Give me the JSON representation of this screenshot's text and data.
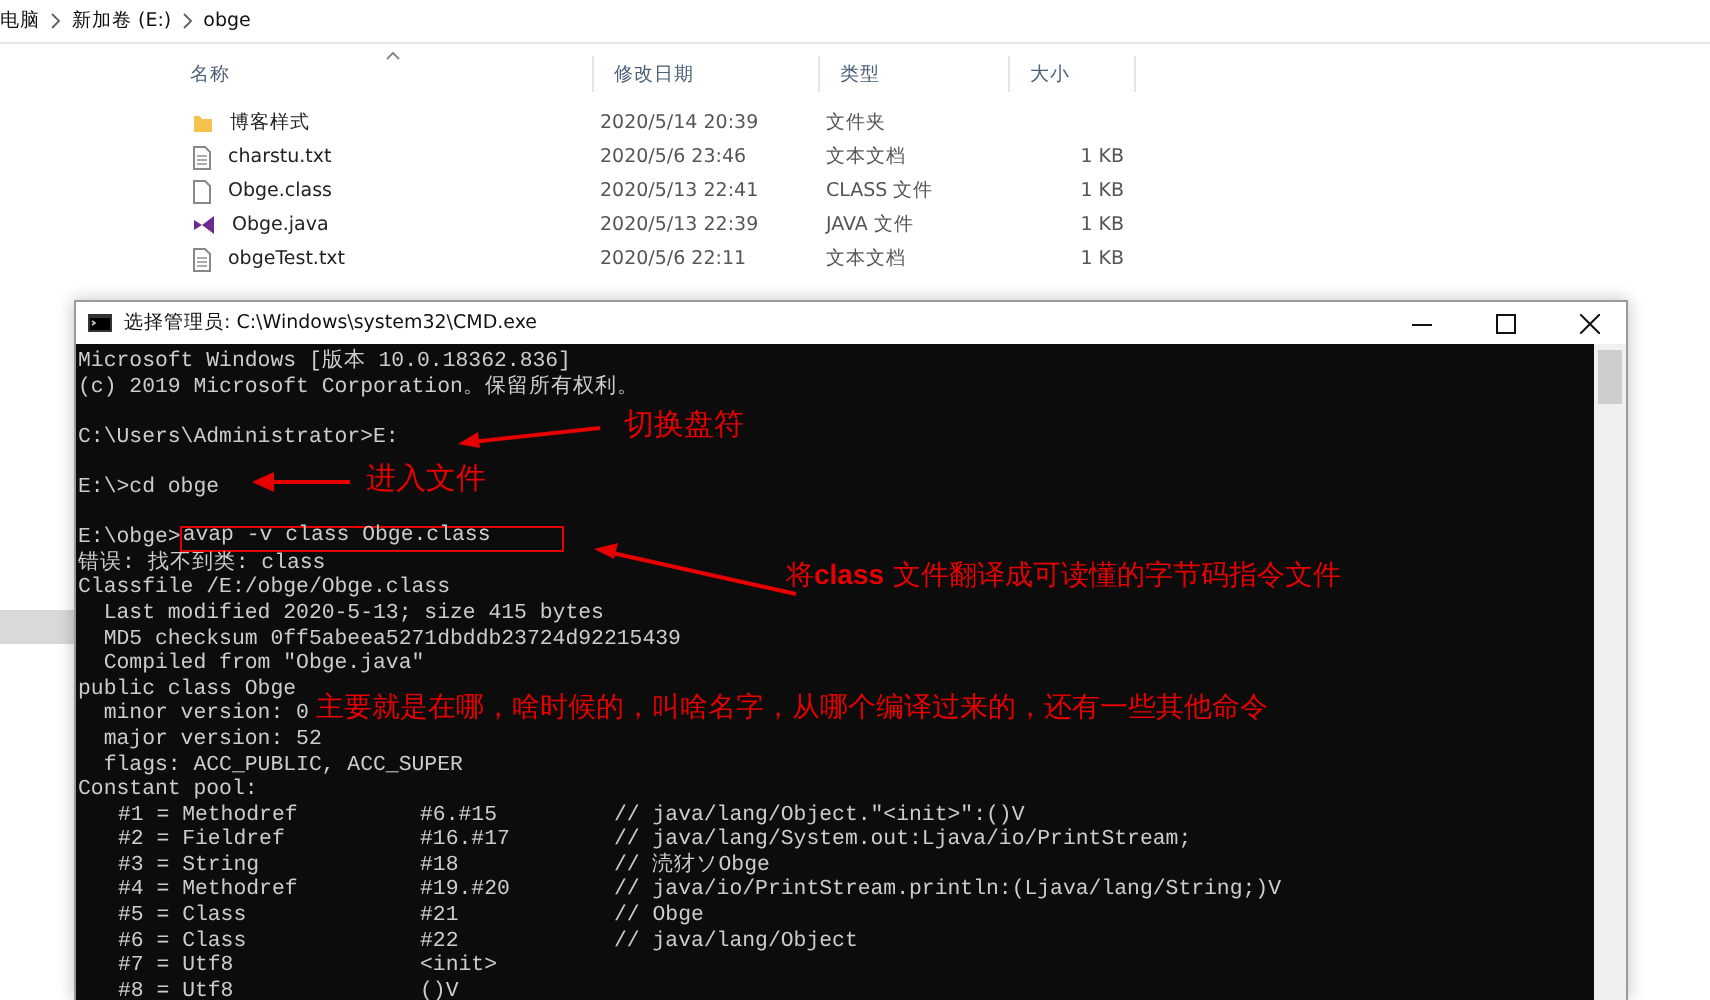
{
  "explorer": {
    "breadcrumb": [
      "电脑",
      "新加卷 (E:)",
      "obge"
    ],
    "columns": [
      {
        "label": "名称",
        "sorted": true
      },
      {
        "label": "修改日期",
        "sorted": false
      },
      {
        "label": "类型",
        "sorted": false
      },
      {
        "label": "大小",
        "sorted": false
      }
    ],
    "files": [
      {
        "kind": "folder",
        "name": "博客样式",
        "modified": "2020/5/14 20:39",
        "type": "文件夹"
      },
      {
        "kind": "text",
        "name": "charstu.txt",
        "modified": "2020/5/6 23:46",
        "type": "文本文档",
        "size": "1 KB"
      },
      {
        "kind": "document",
        "name": "Obge.class",
        "modified": "2020/5/13 22:41",
        "type": "CLASS 文件",
        "size": "1 KB"
      },
      {
        "kind": "java",
        "name": "Obge.java",
        "modified": "2020/5/13 22:39",
        "type": "JAVA 文件",
        "size": "1 KB"
      },
      {
        "kind": "text",
        "name": "obgeTest.txt",
        "modified": "2020/5/6 22:11",
        "type": "文本文档",
        "size": "1 KB"
      }
    ]
  },
  "cmd_window": {
    "title": "选择管理员: C:\\Windows\\system32\\CMD.exe",
    "blocks": [
      [
        "Microsoft Windows [版本 10.0.18362.836]",
        "(c) 2019 Microsoft Corporation。保留所有权利。"
      ],
      [
        "C:\\Users\\Administrator>E:"
      ],
      [
        "E:\\>cd obge"
      ],
      [
        "错误: 找不到类: class",
        "Classfile /E:/obge/Obge.class",
        "  Last modified 2020-5-13; size 415 bytes",
        "  MD5 checksum 0ff5abeea5271dbddb23724d92215439",
        "  Compiled from \"Obge.java\"",
        "public class Obge",
        "  minor version: 0",
        "  major version: 52",
        "  flags: ACC_PUBLIC, ACC_SUPER",
        "Constant pool:"
      ]
    ],
    "command_line": {
      "prompt": "E:\\obge>",
      "command": "avap -v class Obge.class",
      "highlighted": true
    },
    "constant_pool": [
      {
        "entry": "#1 = Methodref",
        "ref": "#6.#15",
        "comment": "// java/lang/Object.\"<init>\":()V"
      },
      {
        "entry": "#2 = Fieldref",
        "ref": "#16.#17",
        "comment": "// java/lang/System.out:Ljava/io/PrintStream;"
      },
      {
        "entry": "#3 = String",
        "ref": "#18",
        "comment": "// 涜犲ソObge"
      },
      {
        "entry": "#4 = Methodref",
        "ref": "#19.#20",
        "comment": "// java/io/PrintStream.println:(Ljava/lang/String;)V"
      },
      {
        "entry": "#5 = Class",
        "ref": "#21",
        "comment": "// Obge"
      },
      {
        "entry": "#6 = Class",
        "ref": "#22",
        "comment": "// java/lang/Object"
      },
      {
        "entry": "#7 = Utf8",
        "ref": "<init>"
      },
      {
        "entry": "#8 = Utf8",
        "ref": "()V"
      }
    ]
  },
  "annotations": [
    "切换盘符",
    "进入文件",
    "将**class** 文件翻译成可读懂的字节码指令文件",
    "主要就是在哪，啥时候的，叫啥名字，从哪个编译过来的，还有一些其他命令"
  ]
}
